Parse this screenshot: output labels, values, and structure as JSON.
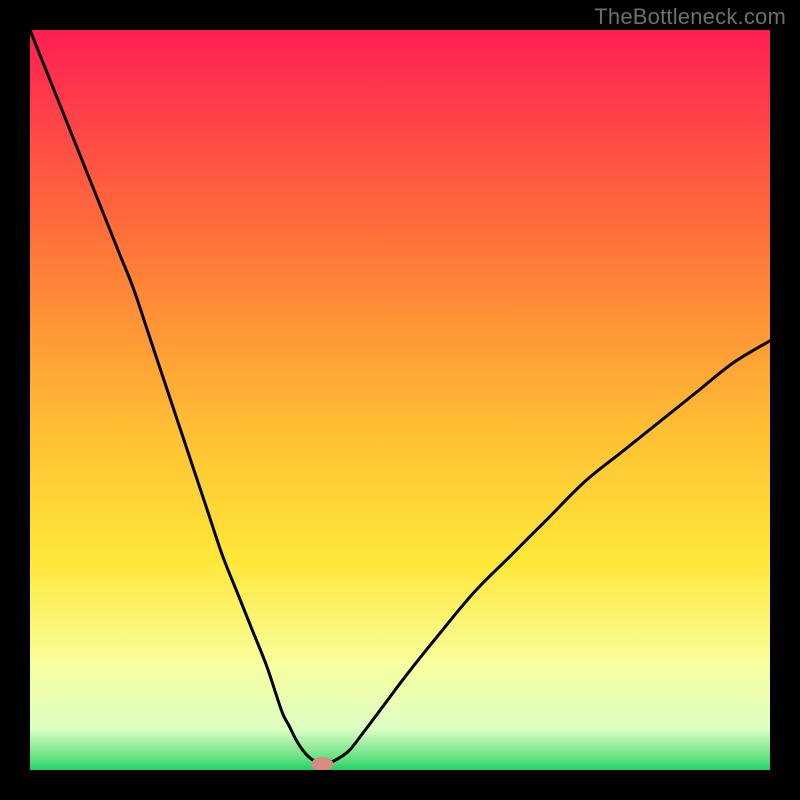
{
  "watermark": "TheBottleneck.com",
  "chart_data": {
    "type": "line",
    "title": "",
    "xlabel": "",
    "ylabel": "",
    "xlim": [
      0,
      100
    ],
    "ylim": [
      0,
      100
    ],
    "x": [
      0,
      2,
      4,
      6,
      8,
      10,
      12,
      14,
      16,
      18,
      20,
      22,
      24,
      26,
      28,
      30,
      32,
      34,
      35,
      36,
      37,
      38,
      39,
      40,
      41,
      43,
      45,
      48,
      51,
      55,
      60,
      65,
      70,
      75,
      80,
      85,
      90,
      95,
      100
    ],
    "values": [
      100,
      95,
      90,
      85,
      80,
      75,
      70,
      65,
      59,
      53,
      47,
      41,
      35,
      29,
      24,
      19,
      14,
      8,
      6,
      4,
      2.5,
      1.5,
      1,
      1,
      1.2,
      2.5,
      5,
      9,
      13,
      18,
      24,
      29,
      34,
      39,
      43,
      47,
      51,
      55,
      58
    ],
    "minimum_marker": {
      "x": 39.5,
      "y": 0.8
    },
    "background_gradient": {
      "stops": [
        {
          "pos": 0.0,
          "color": "#ff1f53"
        },
        {
          "pos": 0.27,
          "color": "#ff6e3a"
        },
        {
          "pos": 0.55,
          "color": "#ffc233"
        },
        {
          "pos": 0.72,
          "color": "#ffe83a"
        },
        {
          "pos": 0.86,
          "color": "#f8ffa0"
        },
        {
          "pos": 0.945,
          "color": "#dcffc4"
        },
        {
          "pos": 0.985,
          "color": "#62e07f"
        },
        {
          "pos": 1.0,
          "color": "#1fd168"
        }
      ]
    }
  }
}
